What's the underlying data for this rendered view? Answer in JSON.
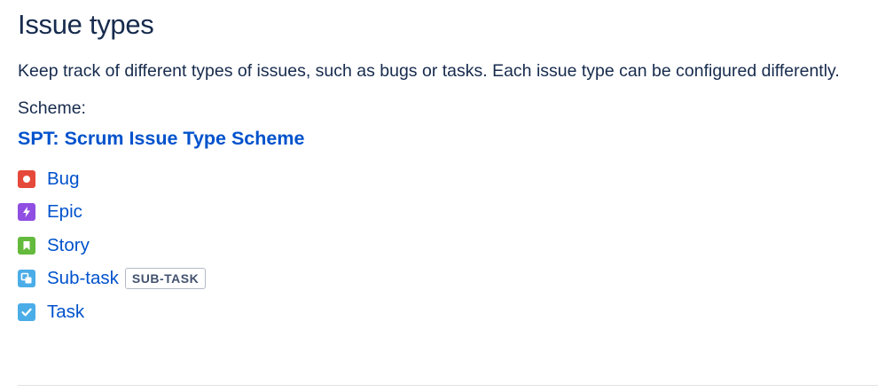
{
  "section": {
    "title": "Issue types",
    "description": "Keep track of different types of issues, such as bugs or tasks. Each issue type can be configured differently.",
    "scheme_label": "Scheme:",
    "scheme_name": "SPT: Scrum Issue Type Scheme"
  },
  "issue_types": [
    {
      "name": "Bug",
      "icon": "bug-icon",
      "color": "#e5493a"
    },
    {
      "name": "Epic",
      "icon": "epic-icon",
      "color": "#904ee2"
    },
    {
      "name": "Story",
      "icon": "story-icon",
      "color": "#63ba3c"
    },
    {
      "name": "Sub-task",
      "icon": "subtask-icon",
      "color": "#4bade8",
      "badge": "SUB-TASK"
    },
    {
      "name": "Task",
      "icon": "task-icon",
      "color": "#4bade8"
    }
  ],
  "colors": {
    "text": "#172b4d",
    "link": "#0052cc",
    "badge_border": "#b3bac5",
    "divider": "#dfe1e6"
  }
}
